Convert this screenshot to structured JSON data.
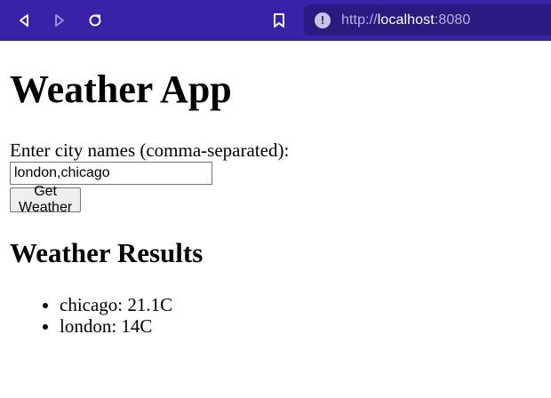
{
  "browser": {
    "url_scheme": "http://",
    "url_host": "localhost",
    "url_port": ":8080",
    "info_icon_glyph": "!",
    "icons": [
      "back-icon",
      "forward-icon",
      "reload-icon",
      "bookmark-icon",
      "info-icon"
    ]
  },
  "page": {
    "title": "Weather App",
    "prompt_label": "Enter city names (comma-separated):",
    "city_input_value": "london,chicago",
    "submit_label": "Get Weather",
    "results_heading": "Weather Results",
    "results": [
      "chicago: 21.1C",
      "london: 14C"
    ]
  },
  "colors": {
    "toolbar": "#3a22a8",
    "urlbar": "#2a1a80"
  }
}
